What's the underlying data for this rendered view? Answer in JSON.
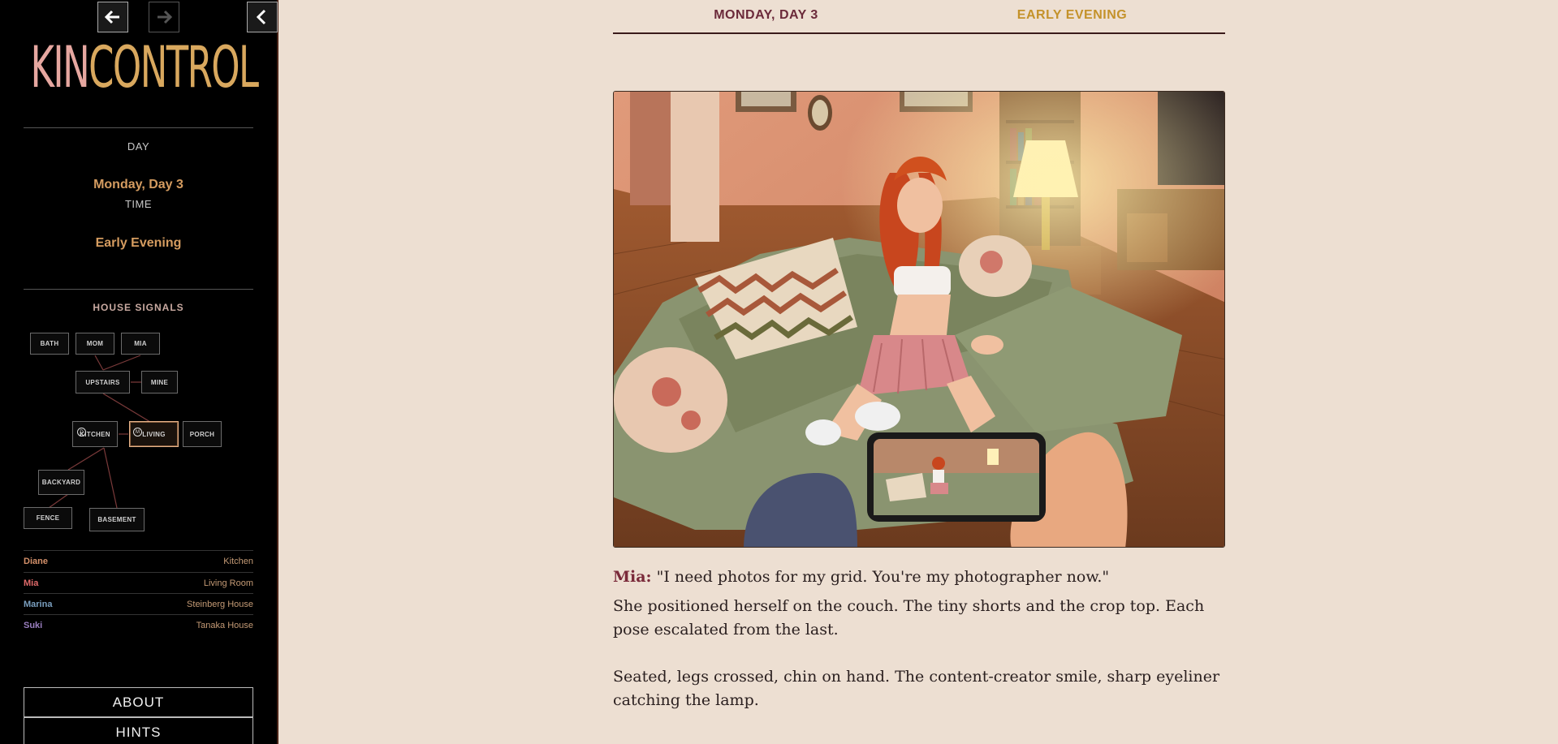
{
  "nav": {
    "back": "back",
    "forward": "forward",
    "collapse": "collapse"
  },
  "logo": {
    "part1": "KIN",
    "part2": "CONTROL"
  },
  "status": {
    "day_label": "DAY",
    "day_value": "Monday, Day 3",
    "time_label": "TIME",
    "time_value": "Early Evening"
  },
  "signals": {
    "title": "HOUSE SIGNALS",
    "rooms": {
      "bath": "BATH",
      "mom": "MOM",
      "mia": "MIA",
      "upstairs": "UPSTAIRS",
      "mine": "MINE",
      "kitchen": "KITCHEN",
      "living": "LIVING",
      "porch": "PORCH",
      "backyard": "BACKYARD",
      "fence": "FENCE",
      "basement": "BASEMENT"
    },
    "markers": {
      "kitchen": "D",
      "living": "M"
    }
  },
  "people": [
    {
      "name": "Diane",
      "location": "Kitchen",
      "color": "#d4906a"
    },
    {
      "name": "Mia",
      "location": "Living Room",
      "color": "#e06a6a"
    },
    {
      "name": "Marina",
      "location": "Steinberg House",
      "color": "#7a9fbf"
    },
    {
      "name": "Suki",
      "location": "Tanaka House",
      "color": "#9a7fc0"
    }
  ],
  "menu": {
    "about": "ABOUT",
    "hints": "HINTS"
  },
  "header": {
    "day": "MONDAY, DAY 3",
    "time": "EARLY EVENING"
  },
  "story": {
    "speaker": "Mia:",
    "quote": "\"I need photos for my grid. You're my photographer now.\"",
    "para1": "She positioned herself on the couch. The tiny shorts and the crop top. Each pose escalated from the last.",
    "para2": "Seated, legs crossed, chin on hand. The content-creator smile, sharp eyeliner catching the lamp."
  },
  "colors": {
    "accent_gold": "#d59c60",
    "header_day": "#6b2a3a",
    "header_time": "#c4922a"
  }
}
